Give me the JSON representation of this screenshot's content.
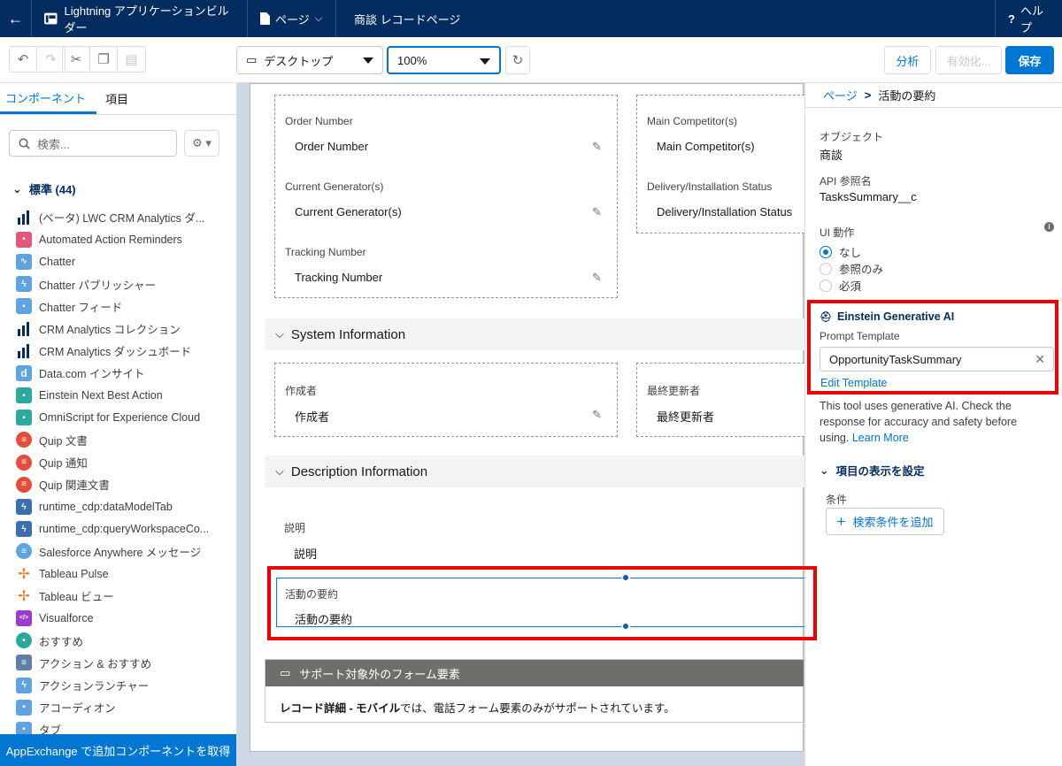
{
  "topbar": {
    "app_title": "Lightning アプリケーションビルダー",
    "page_menu": "ページ",
    "record_title": "商談 レコードページ",
    "help": "ヘルプ"
  },
  "toolbar": {
    "device": "デスクトップ",
    "zoom": "100%",
    "analyze": "分析",
    "activate": "有効化...",
    "save": "保存"
  },
  "left": {
    "tab_components": "コンポーネント",
    "tab_fields": "項目",
    "search_placeholder": "検索...",
    "standard_header": "標準 (44)",
    "appexchange": "AppExchange で追加コンポーネントを取得",
    "components": [
      {
        "label": "(ベータ) LWC CRM Analytics ダ...",
        "color": "#032d60",
        "icon": "bar-chart-icon"
      },
      {
        "label": "Automated Action Reminders",
        "color": "#e3577a",
        "icon": "reminder-icon"
      },
      {
        "label": "Chatter",
        "color": "#5fa4e0",
        "icon": "pulse-icon"
      },
      {
        "label": "Chatter パブリッシャー",
        "color": "#5fa4e0",
        "icon": "bolt-icon"
      },
      {
        "label": "Chatter フィード",
        "color": "#5fa4e0",
        "icon": "feed-icon"
      },
      {
        "label": "CRM Analytics コレクション",
        "color": "#032d60",
        "icon": "bar-chart-icon"
      },
      {
        "label": "CRM Analytics ダッシュボード",
        "color": "#032d60",
        "icon": "bar-chart-icon"
      },
      {
        "label": "Data.com インサイト",
        "color": "#5fa4e0",
        "icon": "datacom-icon"
      },
      {
        "label": "Einstein Next Best Action",
        "color": "#2ba99b",
        "icon": "nba-icon"
      },
      {
        "label": "OmniScript for Experience Cloud",
        "color": "#2ba99b",
        "icon": "omniscript-icon"
      },
      {
        "label": "Quip 文書",
        "color": "#e44d3a",
        "icon": "quip-icon"
      },
      {
        "label": "Quip 通知",
        "color": "#e44d3a",
        "icon": "quip-icon"
      },
      {
        "label": "Quip 関連文書",
        "color": "#e44d3a",
        "icon": "quip-icon"
      },
      {
        "label": "runtime_cdp:dataModelTab",
        "color": "#3a6fb0",
        "icon": "lightning-icon"
      },
      {
        "label": "runtime_cdp:queryWorkspaceCo...",
        "color": "#3a6fb0",
        "icon": "lightning-icon"
      },
      {
        "label": "Salesforce Anywhere メッセージ",
        "color": "#5fa4e0",
        "icon": "message-icon"
      },
      {
        "label": "Tableau Pulse",
        "color": "#ffffff",
        "icon": "tableau-icon"
      },
      {
        "label": "Tableau ビュー",
        "color": "#ffffff",
        "icon": "tableau-icon"
      },
      {
        "label": "Visualforce",
        "color": "#9b3ccf",
        "icon": "code-icon"
      },
      {
        "label": "おすすめ",
        "color": "#2ba99b",
        "icon": "bulb-icon"
      },
      {
        "label": "アクション & おすすめ",
        "color": "#5f7fa8",
        "icon": "list-icon"
      },
      {
        "label": "アクションランチャー",
        "color": "#5fa4e0",
        "icon": "bolt-icon"
      },
      {
        "label": "アコーディオン",
        "color": "#5fa4e0",
        "icon": "accordion-icon"
      },
      {
        "label": "タブ",
        "color": "#5fa4e0",
        "icon": "tabs-icon"
      }
    ]
  },
  "canvas": {
    "fields_top_left": [
      {
        "label": "Order Number",
        "value": "Order Number"
      },
      {
        "label": "Current Generator(s)",
        "value": "Current Generator(s)"
      },
      {
        "label": "Tracking Number",
        "value": "Tracking Number"
      }
    ],
    "fields_top_right": [
      {
        "label": "Main Competitor(s)",
        "value": "Main Competitor(s)"
      },
      {
        "label": "Delivery/Installation Status",
        "value": "Delivery/Installation Status"
      }
    ],
    "system_section": "System Information",
    "created_by": {
      "label": "作成者",
      "value": "作成者"
    },
    "modified_by": {
      "label": "最終更新者",
      "value": "最終更新者"
    },
    "description_section": "Description Information",
    "description": {
      "label": "説明",
      "value": "説明"
    },
    "activity_summary": {
      "label": "活動の要約",
      "value": "活動の要約"
    },
    "unsupported_header": "サポート対象外のフォーム要素",
    "unsupported_bold": "レコード詳細 - モバイル",
    "unsupported_rest": "では、電話フォーム要素のみがサポートされています。"
  },
  "right": {
    "breadcrumb_parent": "ページ",
    "breadcrumb_sep": ">",
    "breadcrumb_current": "活動の要約",
    "object_label": "オブジェクト",
    "object_value": "商談",
    "api_label": "API 参照名",
    "api_value": "TasksSummary__c",
    "ui_label": "UI 動作",
    "ui_options": [
      "なし",
      "参照のみ",
      "必須"
    ],
    "einstein_title": "Einstein Generative AI",
    "prompt_label": "Prompt Template",
    "prompt_value": "OpportunityTaskSummary",
    "edit_template": "Edit Template",
    "disclaimer": "This tool uses generative AI. Check the response for accuracy and safety before using.",
    "learn_more": "Learn More",
    "visibility_header": "項目の表示を設定",
    "condition_label": "条件",
    "add_filter": "検索条件を追加"
  },
  "colors": {
    "brand": "#0176d3",
    "header": "#032d60",
    "highlight": "#e00000"
  }
}
